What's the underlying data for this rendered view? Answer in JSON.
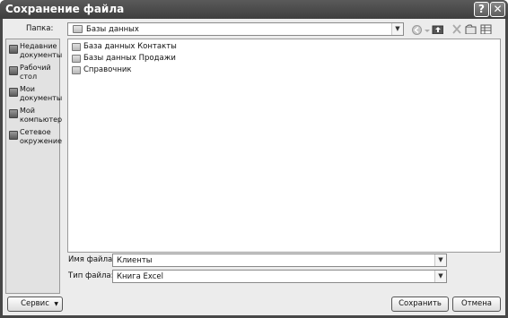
{
  "window": {
    "title": "Сохранение файла",
    "help_glyph": "?",
    "close_glyph": "✕"
  },
  "folder_bar": {
    "label": "Папка:",
    "current_folder": "Базы данных"
  },
  "places": [
    {
      "label": "Недавние документы",
      "icon": "recent-docs-icon"
    },
    {
      "label": "Рабочий стол",
      "icon": "desktop-icon"
    },
    {
      "label": "Мои документы",
      "icon": "my-documents-icon"
    },
    {
      "label": "Мой компьютер",
      "icon": "my-computer-icon"
    },
    {
      "label": "Сетевое окружение",
      "icon": "network-icon"
    }
  ],
  "files": [
    {
      "name": "База данных Контакты"
    },
    {
      "name": "Базы данных Продажи"
    },
    {
      "name": "Справочник"
    }
  ],
  "filename": {
    "label": "Имя файла:",
    "value": "Клиенты"
  },
  "filetype": {
    "label": "Тип файла:",
    "value": "Книга Excel"
  },
  "buttons": {
    "service": "Сервис",
    "save": "Сохранить",
    "cancel": "Отмена"
  }
}
